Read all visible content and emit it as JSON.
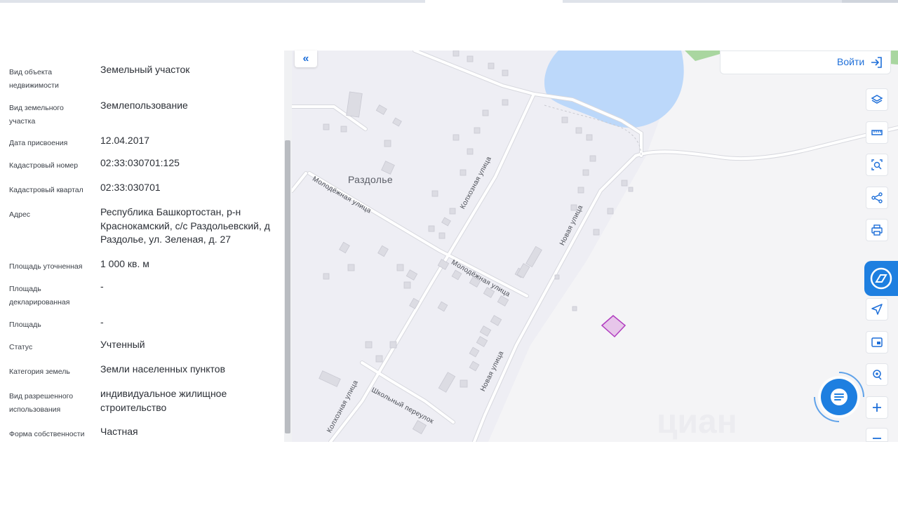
{
  "info": {
    "rows": [
      {
        "label": "Вид объекта недвижимости",
        "value": "Земельный участок"
      },
      {
        "label": "Вид земельного участка",
        "value": "Землепользование"
      },
      {
        "label": "Дата присвоения",
        "value": "12.04.2017"
      },
      {
        "label": "Кадастровый номер",
        "value": "02:33:030701:125"
      },
      {
        "label": "Кадастровый квартал",
        "value": "02:33:030701"
      },
      {
        "label": "Адрес",
        "value": "Республика Башкортостан, р-н Краснокамский, с/с Раздольевский, д Раздолье, ул. Зеленая, д. 27"
      },
      {
        "label": "Площадь уточненная",
        "value": "1 000 кв. м"
      },
      {
        "label": "Площадь декларированная",
        "value": "-"
      },
      {
        "label": "Площадь",
        "value": "-"
      },
      {
        "label": "Статус",
        "value": "Учтенный"
      },
      {
        "label": "Категория земель",
        "value": "Земли населенных пунктов"
      },
      {
        "label": "Вид разрешенного использования",
        "value": "индивидуальное жилищное строительство"
      },
      {
        "label": "Форма собственности",
        "value": "Частная"
      }
    ]
  },
  "map": {
    "town": "Раздолье",
    "streets": {
      "molodezhnaya_1": "Молодёжная улица",
      "molodezhnaya_2": "Молодёжная улица",
      "kolkhoznaya_1": "Колхозная улица",
      "kolkhoznaya_2": "Колхозная улица",
      "novaya_1": "Новая улица",
      "novaya_2": "Новая улица",
      "shkolny": "Школьный переулок"
    },
    "colors": {
      "water": "#bcd8fa",
      "park": "#a9d6a0",
      "parcel_fill": "#e7c6ea",
      "parcel_stroke": "#b03cbf",
      "accent": "#1e6fd9"
    }
  },
  "header": {
    "collapse_icon": "chevron-double-left-icon",
    "login_label": "Войти",
    "login_icon": "login-icon"
  },
  "toolbar": {
    "icons": [
      "layers-icon",
      "ruler-icon",
      "area-search-icon",
      "share-icon",
      "print-icon",
      "brand-logo-icon",
      "navigation-arrow-icon",
      "picture-in-picture-icon",
      "locate-icon",
      "zoom-in-icon",
      "zoom-out-icon"
    ]
  },
  "chat": {
    "icon": "chat-icon"
  }
}
